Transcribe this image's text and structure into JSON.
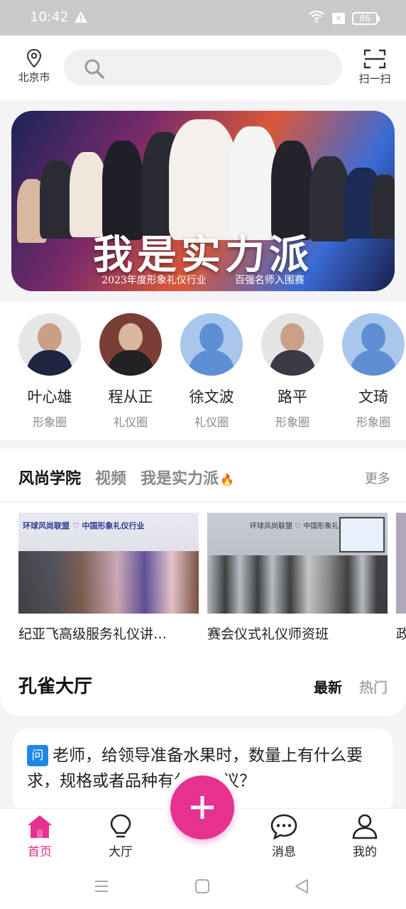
{
  "status": {
    "time": "10:42",
    "battery": "86"
  },
  "header": {
    "location": "北京市",
    "scan_label": "扫一扫",
    "search_placeholder": ""
  },
  "banner": {
    "title": "我是实力派",
    "subtitle_left": "2023年度形象礼仪行业",
    "subtitle_right": "百强名师入围赛"
  },
  "experts": [
    {
      "name": "叶心雄",
      "tag": "形象圈",
      "photo": true
    },
    {
      "name": "程从正",
      "tag": "礼仪圈",
      "photo": true
    },
    {
      "name": "徐文波",
      "tag": "礼仪圈",
      "photo": false
    },
    {
      "name": "路平",
      "tag": "形象圈",
      "photo": true
    },
    {
      "name": "文琦",
      "tag": "形象圈",
      "photo": false
    }
  ],
  "academy": {
    "tabs": [
      "风尚学院",
      "视频",
      "我是实力派"
    ],
    "more": "更多",
    "videos": [
      {
        "caption": "纪亚飞高级服务礼仪讲…",
        "thumb_text": "环球风尚联盟 ♡ 中国形象礼仪行业"
      },
      {
        "caption": "赛会仪式礼仪师资班",
        "thumb_text": "环球风尚联盟 ♡ 中国形象礼仪行业"
      },
      {
        "caption": "政"
      }
    ]
  },
  "hall": {
    "title": "孔雀大厅",
    "tabs": [
      "最新",
      "热门"
    ]
  },
  "post": {
    "badge": "问",
    "text": "老师，给领导准备水果时，数量上有什么要求，规格或者品种有什么建议？"
  },
  "nav": {
    "home": "首页",
    "hall": "大厅",
    "messages": "消息",
    "mine": "我的"
  },
  "colors": {
    "accent": "#e6318f",
    "question_badge": "#1e88e5"
  }
}
